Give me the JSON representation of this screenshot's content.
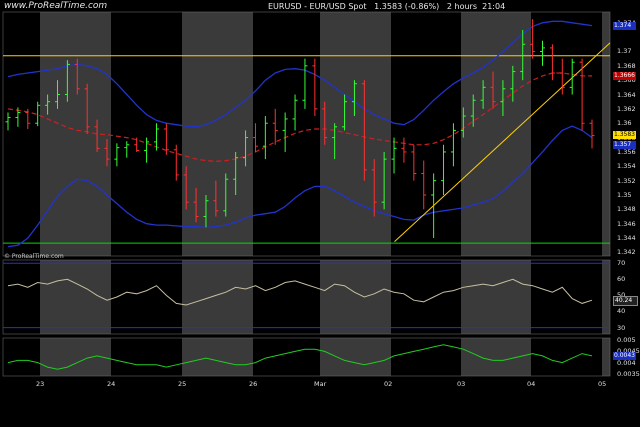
{
  "header": {
    "logo_text": "www.ProRealTime.com",
    "title": "EURUSD - EUR/USD Spot",
    "last_price": "1.3583 (-0.86%)",
    "timeframe": "2 hours",
    "time": "21:04"
  },
  "rsi_logo_text": "© ProRealTime.com",
  "price_axis": {
    "ticks": [
      "1.374",
      "1.37",
      "1.368",
      "1.366",
      "1.364",
      "1.362",
      "1.36",
      "1.358",
      "1.356",
      "1.354",
      "1.352",
      "1.35",
      "1.348",
      "1.346",
      "1.344",
      "1.342"
    ],
    "badges": [
      {
        "label": "1.374",
        "bg": "#1b2fbf",
        "fg": "#fff",
        "value": 1.3735
      },
      {
        "label": "1.3666",
        "bg": "#c00000",
        "fg": "#fff",
        "value": 1.3666
      },
      {
        "label": "1.3583",
        "bg": "#ffe000",
        "fg": "#000",
        "value": 1.3583
      },
      {
        "label": "1.357",
        "bg": "#1b2fbf",
        "fg": "#fff",
        "value": 1.357
      }
    ]
  },
  "rsi_axis": {
    "ticks": [
      "70",
      "60",
      "50",
      "40",
      "30"
    ],
    "badge": "40.24"
  },
  "osc_axis": {
    "ticks": [
      "0.005",
      "0.0045",
      "0.004",
      "0.0035"
    ],
    "badge": "0.0043"
  },
  "x_axis": {
    "labels": [
      "23",
      "24",
      "25",
      "26",
      "Mar",
      "02",
      "03",
      "04",
      "05"
    ]
  },
  "colors": {
    "up_candle": "#33ff33",
    "down_candle": "#ff3030",
    "bollinger": "#2233cc",
    "mid_band": "#cc2020",
    "support_line": "#00dd00",
    "resistance_line": "#ffd000",
    "rsi_line": "#c8bfa0",
    "osc_line": "#22cc22",
    "band_grey": "#3a3a3a"
  },
  "chart_data": {
    "type": "candlestick",
    "title": "EURUSD - EUR/USD Spot",
    "ylim": [
      1.3415,
      1.3755
    ],
    "horizontal_lines": [
      1.3694,
      1.3433
    ],
    "trendline": {
      "from": [
        0.645,
        1.3435
      ],
      "to": [
        1.0,
        1.3712
      ]
    },
    "candles": [
      [
        1.3602,
        1.3615,
        1.359,
        1.3608
      ],
      [
        1.3608,
        1.3622,
        1.3595,
        1.3615
      ],
      [
        1.3615,
        1.362,
        1.3592,
        1.36
      ],
      [
        1.36,
        1.363,
        1.3596,
        1.3625
      ],
      [
        1.3625,
        1.364,
        1.3612,
        1.363
      ],
      [
        1.363,
        1.366,
        1.362,
        1.364
      ],
      [
        1.364,
        1.3688,
        1.363,
        1.3682
      ],
      [
        1.3682,
        1.369,
        1.364,
        1.3648
      ],
      [
        1.3648,
        1.3655,
        1.3585,
        1.3595
      ],
      [
        1.3595,
        1.3605,
        1.356,
        1.3565
      ],
      [
        1.3565,
        1.3578,
        1.354,
        1.355
      ],
      [
        1.355,
        1.3572,
        1.354,
        1.3566
      ],
      [
        1.3566,
        1.3575,
        1.3552,
        1.357
      ],
      [
        1.357,
        1.358,
        1.356,
        1.3562
      ],
      [
        1.3562,
        1.358,
        1.3545,
        1.3574
      ],
      [
        1.3574,
        1.36,
        1.3562,
        1.3592
      ],
      [
        1.3592,
        1.36,
        1.3556,
        1.3563
      ],
      [
        1.3563,
        1.357,
        1.352,
        1.3528
      ],
      [
        1.3528,
        1.354,
        1.348,
        1.349
      ],
      [
        1.349,
        1.351,
        1.3462,
        1.347
      ],
      [
        1.347,
        1.35,
        1.3455,
        1.3492
      ],
      [
        1.3492,
        1.352,
        1.347,
        1.3478
      ],
      [
        1.3478,
        1.353,
        1.347,
        1.3522
      ],
      [
        1.3522,
        1.356,
        1.35,
        1.3552
      ],
      [
        1.3552,
        1.359,
        1.354,
        1.358
      ],
      [
        1.358,
        1.36,
        1.356,
        1.3568
      ],
      [
        1.3568,
        1.361,
        1.355,
        1.36
      ],
      [
        1.36,
        1.362,
        1.357,
        1.359
      ],
      [
        1.359,
        1.3615,
        1.356,
        1.3606
      ],
      [
        1.3606,
        1.364,
        1.359,
        1.3632
      ],
      [
        1.3632,
        1.369,
        1.362,
        1.368
      ],
      [
        1.368,
        1.369,
        1.361,
        1.362
      ],
      [
        1.362,
        1.363,
        1.357,
        1.358
      ],
      [
        1.358,
        1.36,
        1.355,
        1.3595
      ],
      [
        1.3595,
        1.364,
        1.359,
        1.363
      ],
      [
        1.363,
        1.366,
        1.361,
        1.3655
      ],
      [
        1.3655,
        1.366,
        1.352,
        1.3535
      ],
      [
        1.3535,
        1.355,
        1.347,
        1.349
      ],
      [
        1.349,
        1.356,
        1.348,
        1.355
      ],
      [
        1.355,
        1.358,
        1.353,
        1.3565
      ],
      [
        1.3565,
        1.358,
        1.3545,
        1.356
      ],
      [
        1.356,
        1.357,
        1.352,
        1.353
      ],
      [
        1.353,
        1.3548,
        1.348,
        1.35
      ],
      [
        1.35,
        1.353,
        1.344,
        1.352
      ],
      [
        1.352,
        1.357,
        1.35,
        1.356
      ],
      [
        1.356,
        1.36,
        1.354,
        1.359
      ],
      [
        1.359,
        1.3622,
        1.358,
        1.361
      ],
      [
        1.361,
        1.364,
        1.3595,
        1.3632
      ],
      [
        1.3632,
        1.366,
        1.362,
        1.365
      ],
      [
        1.365,
        1.3672,
        1.362,
        1.363
      ],
      [
        1.363,
        1.366,
        1.361,
        1.3648
      ],
      [
        1.3648,
        1.368,
        1.363,
        1.3672
      ],
      [
        1.3672,
        1.373,
        1.366,
        1.371
      ],
      [
        1.371,
        1.3745,
        1.369,
        1.37
      ],
      [
        1.37,
        1.3715,
        1.368,
        1.3705
      ],
      [
        1.3705,
        1.371,
        1.366,
        1.367
      ],
      [
        1.367,
        1.369,
        1.364,
        1.365
      ],
      [
        1.365,
        1.369,
        1.364,
        1.3685
      ],
      [
        1.3685,
        1.369,
        1.359,
        1.36
      ],
      [
        1.36,
        1.3605,
        1.3565,
        1.3583
      ]
    ],
    "upper_band": [
      1.3665,
      1.3668,
      1.367,
      1.3672,
      1.3674,
      1.3676,
      1.368,
      1.3682,
      1.368,
      1.3676,
      1.3668,
      1.3655,
      1.364,
      1.3625,
      1.3612,
      1.3604,
      1.36,
      1.3598,
      1.3596,
      1.3595,
      1.3598,
      1.3604,
      1.3612,
      1.3622,
      1.3632,
      1.3645,
      1.366,
      1.367,
      1.3675,
      1.3676,
      1.3674,
      1.3668,
      1.366,
      1.365,
      1.364,
      1.363,
      1.362,
      1.3612,
      1.3606,
      1.36,
      1.3598,
      1.3605,
      1.3618,
      1.3632,
      1.3644,
      1.3655,
      1.3663,
      1.367,
      1.3678,
      1.3688,
      1.37,
      1.3712,
      1.3725,
      1.3735,
      1.374,
      1.3742,
      1.3742,
      1.374,
      1.3738,
      1.3736
    ],
    "mid_band": [
      1.362,
      1.3618,
      1.3616,
      1.3612,
      1.3606,
      1.36,
      1.3594,
      1.359,
      1.3588,
      1.3585,
      1.3584,
      1.3582,
      1.358,
      1.3577,
      1.3572,
      1.3567,
      1.3562,
      1.3558,
      1.3554,
      1.355,
      1.3548,
      1.3547,
      1.3548,
      1.355,
      1.3554,
      1.356,
      1.3567,
      1.3574,
      1.358,
      1.3586,
      1.359,
      1.3592,
      1.3592,
      1.359,
      1.3587,
      1.3584,
      1.3581,
      1.3578,
      1.3576,
      1.3574,
      1.3572,
      1.357,
      1.357,
      1.3572,
      1.3577,
      1.3584,
      1.3593,
      1.3603,
      1.3612,
      1.3622,
      1.3632,
      1.3642,
      1.3652,
      1.366,
      1.3666,
      1.367,
      1.367,
      1.3668,
      1.3666,
      1.3666
    ],
    "lower_band": [
      1.3428,
      1.343,
      1.344,
      1.3458,
      1.3478,
      1.3498,
      1.3512,
      1.3522,
      1.352,
      1.3512,
      1.35,
      1.3488,
      1.3476,
      1.3466,
      1.346,
      1.3458,
      1.3458,
      1.3457,
      1.3456,
      1.3456,
      1.3455,
      1.3456,
      1.3458,
      1.3462,
      1.3468,
      1.3472,
      1.3474,
      1.3476,
      1.3484,
      1.3496,
      1.3506,
      1.3512,
      1.3512,
      1.3506,
      1.3498,
      1.349,
      1.3484,
      1.3478,
      1.3474,
      1.347,
      1.3466,
      1.3465,
      1.3472,
      1.3476,
      1.3478,
      1.348,
      1.3482,
      1.3486,
      1.349,
      1.3495,
      1.3505,
      1.3518,
      1.353,
      1.3545,
      1.356,
      1.3576,
      1.359,
      1.3596,
      1.359,
      1.358
    ],
    "rsi": [
      56,
      57,
      55,
      58,
      57,
      59,
      60,
      57,
      54,
      50,
      47,
      49,
      52,
      51,
      53,
      56,
      50,
      45,
      44,
      46,
      48,
      50,
      52,
      55,
      54,
      56,
      53,
      55,
      58,
      59,
      57,
      55,
      53,
      57,
      56,
      52,
      49,
      51,
      54,
      52,
      51,
      47,
      46,
      49,
      52,
      53,
      55,
      56,
      57,
      56,
      58,
      60,
      57,
      56,
      54,
      52,
      55,
      48,
      45,
      47
    ],
    "oscillator": [
      0.004,
      0.0041,
      0.0041,
      0.004,
      0.0038,
      0.0037,
      0.0038,
      0.004,
      0.0042,
      0.0043,
      0.0042,
      0.0041,
      0.004,
      0.0039,
      0.0039,
      0.0039,
      0.0038,
      0.0039,
      0.004,
      0.0041,
      0.0042,
      0.0041,
      0.004,
      0.0039,
      0.0039,
      0.004,
      0.0042,
      0.0043,
      0.0044,
      0.0045,
      0.0046,
      0.0046,
      0.0045,
      0.0043,
      0.0041,
      0.004,
      0.0039,
      0.004,
      0.0041,
      0.0043,
      0.0044,
      0.0045,
      0.0046,
      0.0047,
      0.0048,
      0.0047,
      0.0046,
      0.0044,
      0.0042,
      0.0041,
      0.0041,
      0.0042,
      0.0043,
      0.0044,
      0.0043,
      0.0041,
      0.004,
      0.0042,
      0.0044,
      0.0043
    ]
  }
}
